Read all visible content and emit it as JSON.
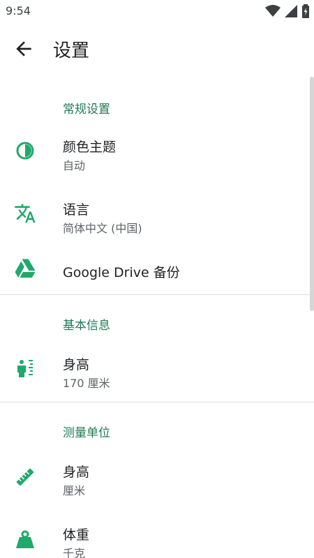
{
  "status_bar": {
    "time": "9:54",
    "icons": [
      "wifi-icon",
      "signal-icon",
      "battery-icon"
    ]
  },
  "app_bar": {
    "title": "设置",
    "back_icon": "arrow-back-icon"
  },
  "accent_color": "#1faa6b",
  "sections": {
    "general": {
      "header": "常规设置",
      "color_theme": {
        "label": "颜色主题",
        "value": "自动",
        "icon": "contrast-icon"
      },
      "language": {
        "label": "语言",
        "value": "简体中文 (中国)",
        "icon": "translate-icon"
      },
      "backup": {
        "label": "Google Drive 备份",
        "icon": "google-drive-icon"
      }
    },
    "basic_info": {
      "header": "基本信息",
      "height": {
        "label": "身高",
        "value": "170 厘米",
        "icon": "person-height-icon"
      }
    },
    "units": {
      "header": "测量单位",
      "height_unit": {
        "label": "身高",
        "value": "厘米",
        "icon": "ruler-icon"
      },
      "weight_unit": {
        "label": "体重",
        "value": "千克",
        "icon": "weight-icon"
      }
    }
  }
}
